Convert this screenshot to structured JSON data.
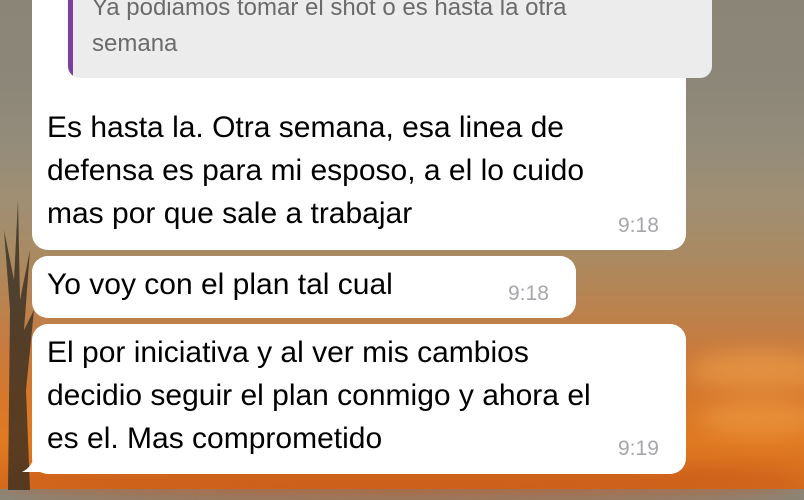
{
  "colors": {
    "bubble": "#ffffff",
    "quote_bar": "#7b3fa0",
    "quote_bg": "#ececec",
    "timestamp": "#a7a7ab"
  },
  "messages": [
    {
      "quote": "Ya podiamos tomar el shot o es hasta la otra\nsemana",
      "text": "Es hasta la. Otra semana, esa linea de\ndefensa es para mi esposo, a el lo cuido\nmas por que sale a trabajar",
      "time": "9:18"
    },
    {
      "text": "Yo voy con el plan tal cual",
      "time": "9:18"
    },
    {
      "text": "El por iniciativa y al ver mis cambios\ndecidio seguir el plan conmigo y ahora el\nes el. Mas comprometido",
      "time": "9:19"
    }
  ]
}
